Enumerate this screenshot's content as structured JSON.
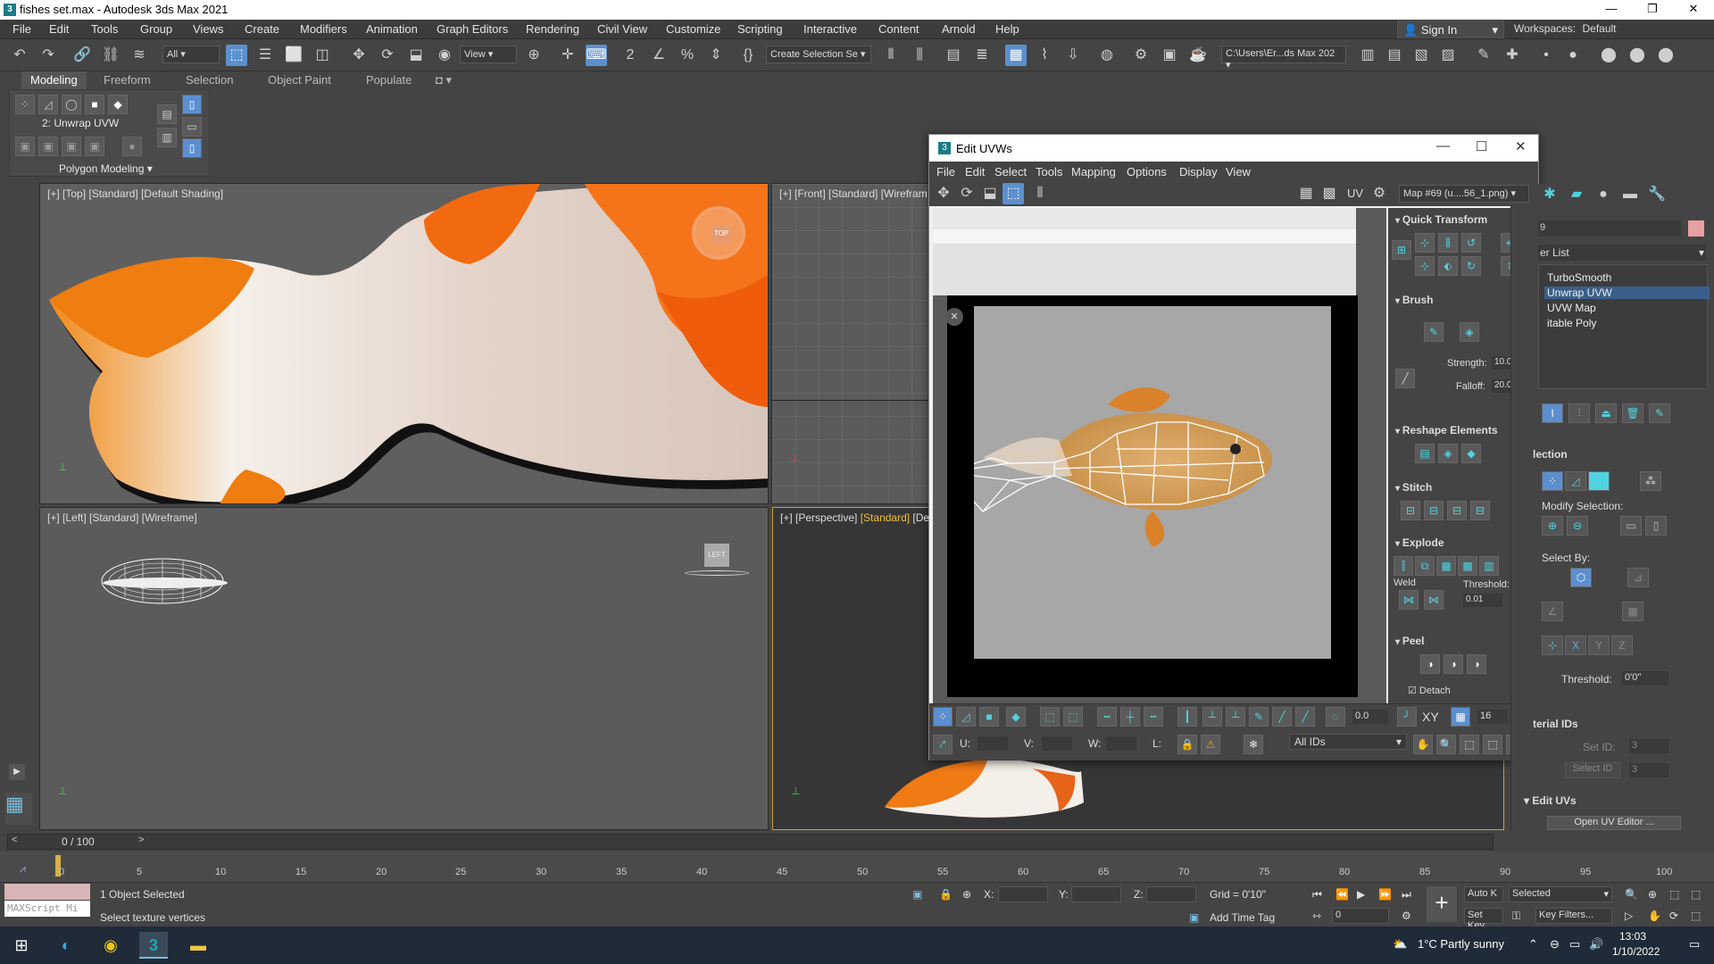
{
  "window": {
    "title": "fishes set.max - Autodesk 3ds Max 2021",
    "app_icon": "3",
    "controls": [
      "—",
      "❐",
      "✕"
    ]
  },
  "menu": [
    "File",
    "Edit",
    "Tools",
    "Group",
    "Views",
    "Create",
    "Modifiers",
    "Animation",
    "Graph Editors",
    "Rendering",
    "Civil View",
    "Customize",
    "Scripting",
    "Interactive",
    "Content",
    "Arnold",
    "Help"
  ],
  "signin": "Sign In",
  "workspaces": {
    "label": "Workspaces:",
    "value": "Default"
  },
  "toolbar": {
    "filter": "All",
    "view": "View",
    "selection_set": "Create Selection Se",
    "path": "C:\\Users\\Er...ds Max 202"
  },
  "ribbon": {
    "tabs": [
      "Modeling",
      "Freeform",
      "Selection",
      "Object Paint",
      "Populate"
    ],
    "modifier_label": "2: Unwrap UVW",
    "panel_label": "Polygon Modeling"
  },
  "viewports": {
    "top": {
      "prefix": "[+] [Top] [Standard] [Default Shading]",
      "cube": "TOP"
    },
    "front": {
      "prefix": "[+] [Front] [Standard] [Wirefram"
    },
    "left": {
      "prefix": "[+] [Left] [Standard] [Wireframe]",
      "cube": "LEFT"
    },
    "perspective": {
      "prefix": "[+] [Perspective] ",
      "active": "[Standard]",
      "suffix": " [De"
    }
  },
  "edit_uvws": {
    "title": "Edit UVWs",
    "icon": "3",
    "controls": [
      "—",
      "☐",
      "✕"
    ],
    "menu": [
      "File",
      "Edit",
      "Select",
      "Tools",
      "Mapping",
      "Options",
      "Display",
      "View"
    ],
    "uv_label": "UV",
    "map": "Map #69 (u....56_1.png)",
    "sections": {
      "quick_transform": "Quick Transform",
      "brush": "Brush",
      "reshape": "Reshape Elements",
      "stitch": "Stitch",
      "explode": "Explode",
      "peel": "Peel"
    },
    "strength": {
      "label": "Strength:",
      "value": "10.0"
    },
    "falloff": {
      "label": "Falloff:",
      "value": "20.0"
    },
    "weld": "Weld",
    "threshold": {
      "label": "Threshold:",
      "value": "0.01"
    },
    "detach": "Detach",
    "bottom": {
      "angle": "0.0",
      "xy": "XY",
      "grid": "16",
      "u": "U:",
      "v": "V:",
      "w": "W:",
      "l": "L:",
      "ids": "All IDs"
    }
  },
  "command_panel": {
    "search_value": "9",
    "list_label": "er List",
    "modifiers": [
      "TurboSmooth",
      "Unwrap UVW",
      "UVW Map",
      "itable Poly"
    ],
    "selection_header": "lection",
    "modify_selection": "Modify Selection:",
    "select_by": "Select By:",
    "threshold": {
      "label": "Threshold:",
      "value": "0'0\""
    },
    "material_ids": "terial IDs",
    "set_id": "Set ID:",
    "set_id_value": "3",
    "select_id": "Select ID",
    "select_id_value": "3",
    "edit_uvs": "Edit UVs",
    "open_uv_editor": "Open UV Editor ..."
  },
  "timeline": {
    "position": "0 / 100",
    "ticks": [
      "0",
      "5",
      "10",
      "15",
      "20",
      "25",
      "30",
      "35",
      "40",
      "45",
      "50",
      "55",
      "60",
      "65",
      "70",
      "75",
      "80",
      "85",
      "90",
      "95",
      "100"
    ]
  },
  "status": {
    "maxscript": "MAXScript Mi",
    "selected": "1 Object Selected",
    "prompt": "Select texture vertices",
    "x": "X:",
    "y": "Y:",
    "z": "Z:",
    "grid": "Grid = 0'10\"",
    "add_time_tag": "Add Time Tag",
    "auto_key": "Auto K",
    "selected_dropdown": "Selected",
    "set_key": "Set Key",
    "key_filters": "Key Filters...",
    "frame": "0"
  },
  "taskbar": {
    "weather": "1°C  Partly sunny",
    "time": "13:03",
    "date": "1/10/2022"
  },
  "colors": {
    "accent": "#5b8fd0",
    "uv_icon": "#4fd3e0",
    "active_viewport": "#f0c040"
  }
}
